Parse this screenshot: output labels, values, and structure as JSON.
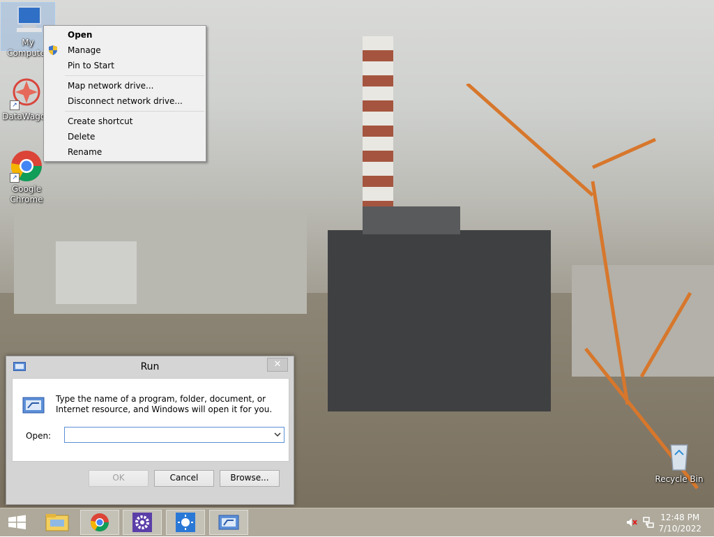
{
  "desktop": {
    "icons": [
      {
        "label": "My Computer"
      },
      {
        "label": "DataWagon"
      },
      {
        "label": "Google Chrome"
      },
      {
        "label": "Recycle Bin"
      }
    ]
  },
  "context_menu": {
    "items": [
      {
        "label": "Open",
        "bold": true
      },
      {
        "label": "Manage"
      },
      {
        "label": "Pin to Start"
      },
      {
        "label": "Map network drive..."
      },
      {
        "label": "Disconnect network drive..."
      },
      {
        "label": "Create shortcut"
      },
      {
        "label": "Delete"
      },
      {
        "label": "Rename"
      }
    ]
  },
  "run_dialog": {
    "title": "Run",
    "close_glyph": "✕",
    "description": "Type the name of a program, folder, document, or Internet resource, and Windows will open it for you.",
    "open_label": "Open:",
    "input_value": "",
    "ok_label": "OK",
    "cancel_label": "Cancel",
    "browse_label": "Browse..."
  },
  "taskbar": {
    "items": [
      "start-icon",
      "file-explorer-icon",
      "chrome-icon",
      "settings-icon",
      "weather-icon",
      "run-icon"
    ],
    "time": "12:48 PM",
    "date": "7/10/2022"
  },
  "colors": {
    "accent": "#5b8fd6",
    "taskbar": "#aaa496"
  }
}
